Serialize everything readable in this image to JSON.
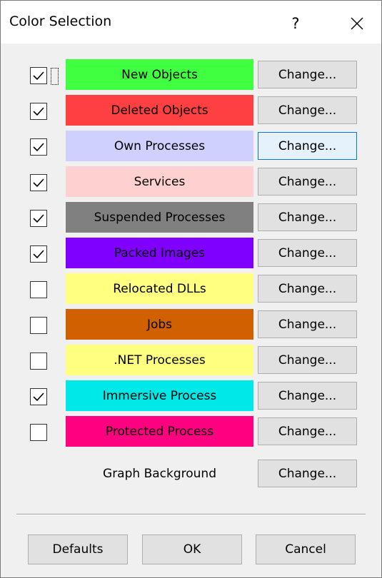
{
  "window": {
    "title": "Color Selection",
    "help_label": "?",
    "close_icon": "close-icon"
  },
  "rows": [
    {
      "label": "New Objects",
      "checked": true,
      "color": "#40ff40",
      "text_color": "#000000",
      "button": "Change..."
    },
    {
      "label": "Deleted Objects",
      "checked": true,
      "color": "#ff4040",
      "text_color": "#000000",
      "button": "Change..."
    },
    {
      "label": "Own Processes",
      "checked": true,
      "color": "#d0d0ff",
      "text_color": "#000000",
      "button": "Change..."
    },
    {
      "label": "Services",
      "checked": true,
      "color": "#ffd0d0",
      "text_color": "#000000",
      "button": "Change..."
    },
    {
      "label": "Suspended Processes",
      "checked": true,
      "color": "#808080",
      "text_color": "#000000",
      "button": "Change..."
    },
    {
      "label": "Packed Images",
      "checked": true,
      "color": "#8000ff",
      "text_color": "#000000",
      "button": "Change..."
    },
    {
      "label": "Relocated DLLs",
      "checked": false,
      "color": "#ffff80",
      "text_color": "#000000",
      "button": "Change..."
    },
    {
      "label": "Jobs",
      "checked": false,
      "color": "#d06000",
      "text_color": "#000000",
      "button": "Change..."
    },
    {
      "label": ".NET Processes",
      "checked": false,
      "color": "#ffff80",
      "text_color": "#000000",
      "button": "Change..."
    },
    {
      "label": "Immersive Process",
      "checked": true,
      "color": "#00e8e8",
      "text_color": "#000000",
      "button": "Change..."
    },
    {
      "label": "Protected Process",
      "checked": false,
      "color": "#ff0080",
      "text_color": "#000000",
      "button": "Change..."
    }
  ],
  "graph": {
    "label": "Graph Background",
    "button": "Change..."
  },
  "footer": {
    "defaults_label": "Defaults",
    "ok_label": "OK",
    "cancel_label": "Cancel"
  },
  "accent": "#0078d7"
}
